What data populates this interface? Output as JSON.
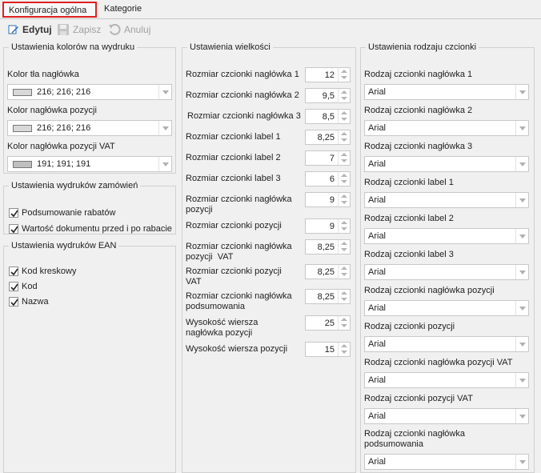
{
  "tabs": [
    {
      "label": "Konfiguracja ogólna",
      "active": true
    },
    {
      "label": "Kategorie",
      "active": false
    }
  ],
  "toolbar": {
    "edit": "Edytuj",
    "save": "Zapisz",
    "cancel": "Anuluj"
  },
  "colors_group": {
    "legend": "Ustawienia kolorów na wydruku",
    "items": [
      {
        "label": "Kolor tła nagłówka",
        "value": "216; 216; 216",
        "swatch": "#d8d8d8"
      },
      {
        "label": "Kolor nagłówka pozycji",
        "value": "216; 216; 216",
        "swatch": "#d8d8d8"
      },
      {
        "label": "Kolor nagłówka pozycji VAT",
        "value": "191; 191; 191",
        "swatch": "#bfbfbf"
      }
    ]
  },
  "orders_group": {
    "legend": "Ustawienia wydruków zamówień",
    "items": [
      {
        "label": "Podsumowanie rabatów",
        "checked": true
      },
      {
        "label": "Wartość dokumentu przed i po rabacie",
        "checked": true
      }
    ]
  },
  "ean_group": {
    "legend": "Ustawienia wydruków EAN",
    "items": [
      {
        "label": "Kod kreskowy",
        "checked": true
      },
      {
        "label": "Kod",
        "checked": true
      },
      {
        "label": "Nazwa",
        "checked": true
      }
    ]
  },
  "size_group": {
    "legend": "Ustawienia wielkości",
    "items": [
      {
        "label": "Rozmiar czcionki nagłówka 1",
        "value": "12"
      },
      {
        "label": "Rozmiar czcionki nagłówka 2",
        "value": "9,5"
      },
      {
        "label": "Rozmiar czcionki nagłówka 3",
        "value": "8,5"
      },
      {
        "label": "Rozmiar czcionki label 1",
        "value": "8,25"
      },
      {
        "label": "Rozmiar czcionki label 2",
        "value": "7"
      },
      {
        "label": "Rozmiar czcionki label 3",
        "value": "6"
      },
      {
        "label_l1": "Rozmiar czcionki nagłówka",
        "label_l2": "pozycji",
        "value": "9"
      },
      {
        "label": "Rozmiar czcionki pozycji",
        "value": "9"
      },
      {
        "label_l1": "Rozmiar czcionki nagłówka",
        "label_l2": "pozycji  VAT",
        "value": "8,25"
      },
      {
        "label_l1": "Rozmiar czcionki pozycji",
        "label_l2": "VAT",
        "value": "8,25"
      },
      {
        "label_l1": "Rozmiar czcionki nagłówka",
        "label_l2": "podsumowania",
        "value": "8,25"
      },
      {
        "label_l1": "Wysokość wiersza",
        "label_l2": "nagłówka pozycji",
        "value": "25"
      },
      {
        "label": "Wysokość wiersza pozycji",
        "value": "15"
      }
    ]
  },
  "font_group": {
    "legend": "Ustawienia rodzaju czcionki",
    "items": [
      {
        "label": "Rodzaj czcionki nagłówka 1",
        "value": "Arial"
      },
      {
        "label": "Rodzaj czcionki nagłówka 2",
        "value": "Arial"
      },
      {
        "label": "Rodzaj czcionki nagłówka 3",
        "value": "Arial"
      },
      {
        "label": "Rodzaj czcionki label 1",
        "value": "Arial"
      },
      {
        "label": "Rodzaj czcionki label 2",
        "value": "Arial"
      },
      {
        "label": "Rodzaj czcionki label 3",
        "value": "Arial"
      },
      {
        "label": "Rodzaj czcionki nagłówka pozycji",
        "value": "Arial"
      },
      {
        "label": "Rodzaj czcionki pozycji",
        "value": "Arial"
      },
      {
        "label": "Rodzaj czcionki nagłówka pozycji VAT",
        "value": "Arial"
      },
      {
        "label": "Rodzaj czcionki pozycji VAT",
        "value": "Arial"
      },
      {
        "label_l1": "Rodzaj czcionki nagłówka",
        "label_l2": "podsumowania",
        "value": "Arial"
      }
    ]
  },
  "style": {
    "active_tab_border": "#e02020",
    "background": "#f0f0f0",
    "edit_icon": "pencil-icon",
    "save_icon": "floppy-disk-icon",
    "cancel_icon": "undo-icon"
  }
}
